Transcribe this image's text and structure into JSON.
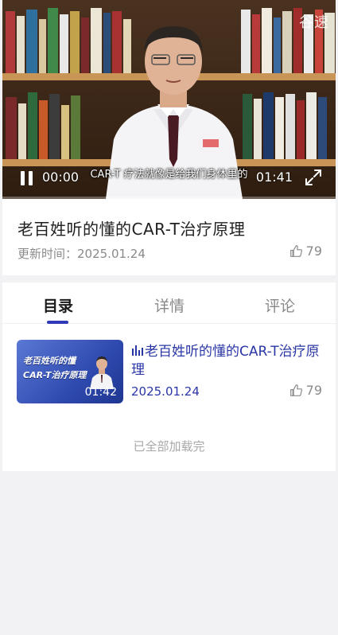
{
  "video": {
    "watermark": "谷速",
    "caption": "CAR-T 疗法就像是给我们身体里的",
    "current_time": "00:00",
    "duration": "01:41",
    "progress": 0
  },
  "info": {
    "title": "老百姓听的懂的CAR-T治疗原理",
    "update_label": "更新时间：2025.01.24",
    "likes": "79"
  },
  "tabs": [
    {
      "label": "目录",
      "active": true
    },
    {
      "label": "详情",
      "active": false
    },
    {
      "label": "评论",
      "active": false
    }
  ],
  "episodes": [
    {
      "cover_line1": "老百姓听的懂",
      "cover_line2": "CAR-T治疗原理",
      "duration": "01:42",
      "title": "老百姓听的懂的CAR-T治疗原理",
      "date": "2025.01.24",
      "likes": "79"
    }
  ],
  "list_end_text": "已全部加载完",
  "colors": {
    "accent": "#2f3ab8",
    "link": "#2a36a6",
    "muted": "#8a8a8a",
    "page_bg": "#f2f2f4"
  }
}
